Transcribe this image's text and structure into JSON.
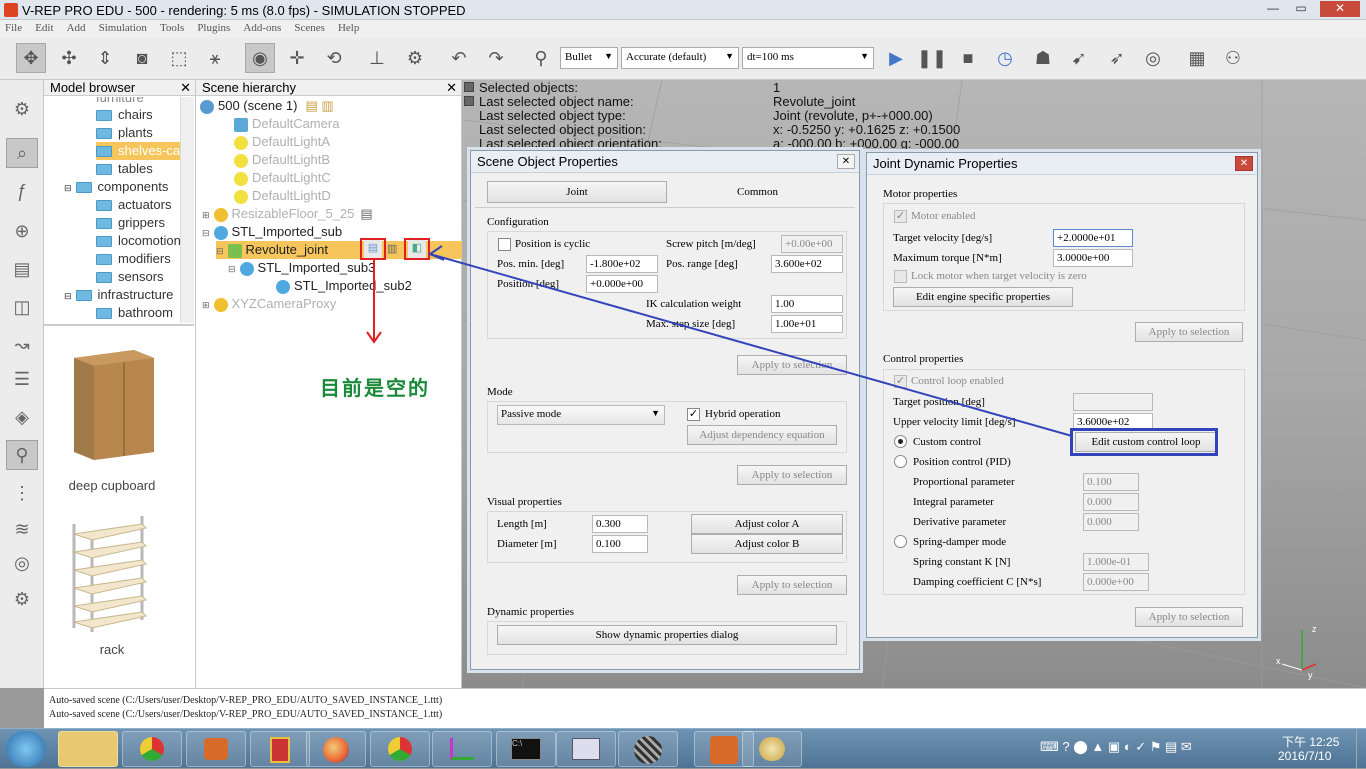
{
  "window": {
    "title": "V-REP PRO EDU - 500 - rendering: 5 ms (8.0 fps) - SIMULATION STOPPED",
    "minimize": "—",
    "maximize": "▭",
    "close": "✕"
  },
  "menu": [
    "File",
    "Edit",
    "Add",
    "Simulation",
    "Tools",
    "Plugins",
    "Add-ons",
    "Scenes",
    "Help"
  ],
  "toolbar": {
    "engine": "Bullet",
    "accuracy": "Accurate (default)",
    "timestep": "dt=100 ms"
  },
  "model_browser": {
    "title": "Model browser",
    "close": "✕",
    "items": [
      "furniture",
      "chairs",
      "plants",
      "shelves-cabinets",
      "tables",
      "components",
      "actuators",
      "grippers",
      "locomotion",
      "modifiers",
      "sensors",
      "infrastructure",
      "bathroom"
    ],
    "thumbnails": [
      "deep cupboard",
      "rack"
    ]
  },
  "scene_hierarchy": {
    "title": "Scene hierarchy",
    "close": "✕",
    "rows": [
      "500 (scene 1)",
      "DefaultCamera",
      "DefaultLightA",
      "DefaultLightB",
      "DefaultLightC",
      "DefaultLightD",
      "ResizableFloor_5_25",
      "STL_Imported_sub",
      "Revolute_joint",
      "STL_Imported_sub3",
      "STL_Imported_sub2",
      "XYZCameraProxy"
    ]
  },
  "annotation": {
    "text": "目前是空的",
    "color": "#1a8a3a"
  },
  "info": {
    "labels": [
      "Selected objects:",
      "Last selected object name:",
      "Last selected object type:",
      "Last selected object position:",
      "Last selected object orientation:"
    ],
    "values": [
      "1",
      "Revolute_joint",
      "Joint (revolute, p+-+000.00)",
      "x: -0.5250    y: +0.1625    z: +0.1500",
      "a: -000.00    b: +000.00    g: -000.00"
    ]
  },
  "scene_props": {
    "title": "Scene Object Properties",
    "close": "✕",
    "tab_joint": "Joint",
    "tab_common": "Common",
    "config_label": "Configuration",
    "cyclic": "Position is cyclic",
    "screw": "Screw pitch [m/deg]",
    "screw_val": "+0.00e+00",
    "pos_min": "Pos. min. [deg]",
    "pos_min_val": "-1.800e+02",
    "pos_range": "Pos. range [deg]",
    "pos_range_val": "3.600e+02",
    "position": "Position [deg]",
    "position_val": "+0.000e+00",
    "ik_weight": "IK calculation weight",
    "ik_weight_val": "1.00",
    "max_step": "Max. step size [deg]",
    "max_step_val": "1.00e+01",
    "apply": "Apply to selection",
    "mode_label": "Mode",
    "mode_val": "Passive mode",
    "hybrid": "Hybrid operation",
    "adjust_dep": "Adjust dependency equation",
    "visual_label": "Visual properties",
    "length": "Length [m]",
    "length_val": "0.300",
    "diameter": "Diameter [m]",
    "diameter_val": "0.100",
    "color_a": "Adjust color A",
    "color_b": "Adjust color B",
    "dyn_label": "Dynamic properties",
    "dyn_btn": "Show dynamic properties dialog"
  },
  "joint_dyn": {
    "title": "Joint Dynamic Properties",
    "close": "✕",
    "motor_label": "Motor properties",
    "motor_enabled": "Motor enabled",
    "target_vel": "Target velocity [deg/s]",
    "target_vel_val": "+2.0000e+01",
    "max_torque": "Maximum torque [N*m]",
    "max_torque_val": "3.0000e+00",
    "lock_motor": "Lock motor when target velocity is zero",
    "edit_engine": "Edit engine specific properties",
    "apply": "Apply to selection",
    "control_label": "Control properties",
    "loop_enabled": "Control loop enabled",
    "target_pos": "Target position [deg]",
    "upper_vel": "Upper velocity limit [deg/s]",
    "upper_vel_val": "3.6000e+02",
    "custom": "Custom control",
    "edit_custom": "Edit custom control loop",
    "pid": "Position control (PID)",
    "prop": "Proportional parameter",
    "prop_val": "0.100",
    "integral": "Integral parameter",
    "integral_val": "0.000",
    "deriv": "Derivative parameter",
    "deriv_val": "0.000",
    "spring": "Spring-damper mode",
    "spring_k": "Spring constant K [N]",
    "spring_k_val": "1.000e-01",
    "damping": "Damping coefficient C [N*s]",
    "damping_val": "0.000e+00"
  },
  "console": [
    "Auto-saved scene (C:/Users/user/Desktop/V-REP_PRO_EDU/AUTO_SAVED_INSTANCE_1.ttt)",
    "Auto-saved scene (C:/Users/user/Desktop/V-REP_PRO_EDU/AUTO_SAVED_INSTANCE_1.ttt)"
  ],
  "taskbar": {
    "time": "下午 12:25",
    "date": "2016/7/10"
  }
}
